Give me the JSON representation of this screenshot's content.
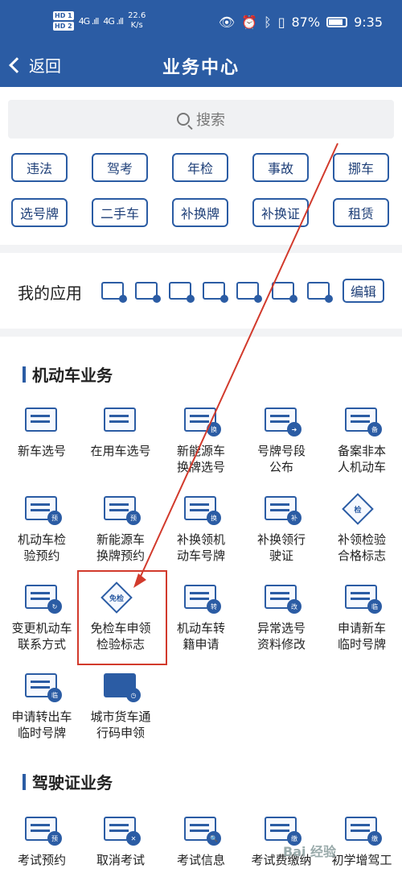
{
  "status": {
    "hd1": "HD 1",
    "hd2": "HD 2",
    "sig1": "4G .ıll",
    "sig2": "4G .ıll",
    "speed_value": "22.6",
    "speed_unit": "K/s",
    "battery": "87%",
    "time": "9:35"
  },
  "nav": {
    "back": "返回",
    "title": "业务中心"
  },
  "search": {
    "placeholder": "搜索"
  },
  "chips": [
    "违法",
    "驾考",
    "年检",
    "事故",
    "挪车",
    "选号牌",
    "二手车",
    "补换牌",
    "补换证",
    "租赁"
  ],
  "myapps": {
    "title": "我的应用",
    "edit": "编辑"
  },
  "sections": {
    "vehicle": "机动车业务",
    "license": "驾驶证业务"
  },
  "vehicle_tiles": [
    {
      "l1": "新车选号",
      "l2": ""
    },
    {
      "l1": "在用车选号",
      "l2": ""
    },
    {
      "l1": "新能源车",
      "l2": "换牌选号"
    },
    {
      "l1": "号牌号段",
      "l2": "公布"
    },
    {
      "l1": "备案非本",
      "l2": "人机动车"
    },
    {
      "l1": "机动车检",
      "l2": "验预约"
    },
    {
      "l1": "新能源车",
      "l2": "换牌预约"
    },
    {
      "l1": "补换领机",
      "l2": "动车号牌"
    },
    {
      "l1": "补换领行",
      "l2": "驶证"
    },
    {
      "l1": "补领检验",
      "l2": "合格标志"
    },
    {
      "l1": "变更机动车",
      "l2": "联系方式"
    },
    {
      "l1": "免检车申领",
      "l2": "检验标志"
    },
    {
      "l1": "机动车转",
      "l2": "籍申请"
    },
    {
      "l1": "异常选号",
      "l2": "资料修改"
    },
    {
      "l1": "申请新车",
      "l2": "临时号牌"
    },
    {
      "l1": "申请转出车",
      "l2": "临时号牌"
    },
    {
      "l1": "城市货车通",
      "l2": "行码申领"
    }
  ],
  "badges": {
    "huan": "换",
    "jian": "检",
    "yu": "预",
    "bu": "补",
    "mianjian": "免检",
    "zhuan": "转",
    "gai": "改",
    "lin": "临",
    "bei": "备",
    "jiao": "缴"
  },
  "license_tiles": [
    {
      "l1": "考试预约",
      "l2": ""
    },
    {
      "l1": "取消考试",
      "l2": ""
    },
    {
      "l1": "考试信息",
      "l2": ""
    },
    {
      "l1": "考试费缴纳",
      "l2": ""
    },
    {
      "l1": "初学增驾工",
      "l2": ""
    }
  ],
  "watermark": "Bai 经验"
}
